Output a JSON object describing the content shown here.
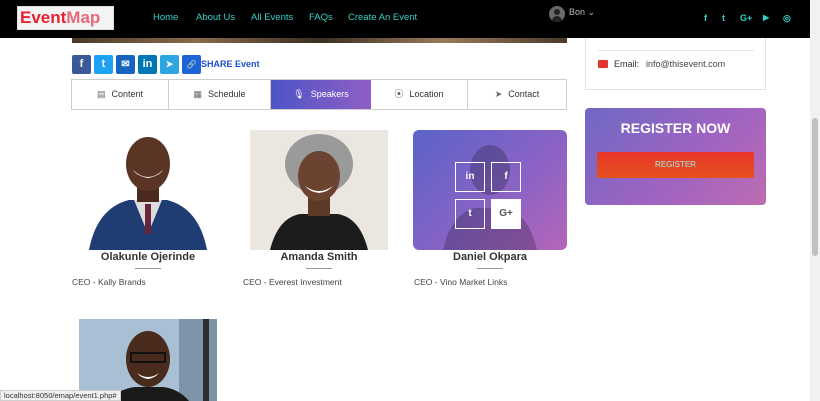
{
  "logo": {
    "part1": "Event",
    "part2": "Map"
  },
  "nav": {
    "links": [
      "Home",
      "About Us",
      "All Events",
      "FAQs",
      "Create An Event"
    ]
  },
  "user": {
    "name": "Bon",
    "caret": "⌄"
  },
  "social_header": [
    "f",
    "t",
    "G+",
    "▶",
    "◎"
  ],
  "share": {
    "label": "SHARE Event",
    "icons": [
      "f",
      "t",
      "✉",
      "in",
      "➤",
      "🔗"
    ]
  },
  "tabs": [
    {
      "label": "Content",
      "icon": "document-icon",
      "glyph": "▤"
    },
    {
      "label": "Schedule",
      "icon": "calendar-icon",
      "glyph": "▦"
    },
    {
      "label": "Speakers",
      "icon": "microphone-icon",
      "glyph": "🎙"
    },
    {
      "label": "Location",
      "icon": "map-pin-icon",
      "glyph": "⦿"
    },
    {
      "label": "Contact",
      "icon": "send-icon",
      "glyph": "➤"
    }
  ],
  "speakers": [
    {
      "name": "Olakunle Ojerinde",
      "role": "CEO - Kally Brands"
    },
    {
      "name": "Amanda Smith",
      "role": "CEO - Everest Investment"
    },
    {
      "name": "Daniel Okpara",
      "role": "CEO - Vino Market Links"
    }
  ],
  "overlay_social": [
    "in",
    "f",
    "t",
    "G+"
  ],
  "contact": {
    "email_label": "Email:",
    "email_value": "info@thisevent.com"
  },
  "register": {
    "title": "REGISTER NOW",
    "button": "REGISTER"
  },
  "status_bar": "localhost:8050/emap/event1.php#",
  "colors": {
    "nav_bg": "#000000",
    "nav_link": "#32d1c6",
    "accent_purple": "#8f5fc4",
    "register_btn": "#e8342a",
    "logo_red": "#e8202f"
  }
}
